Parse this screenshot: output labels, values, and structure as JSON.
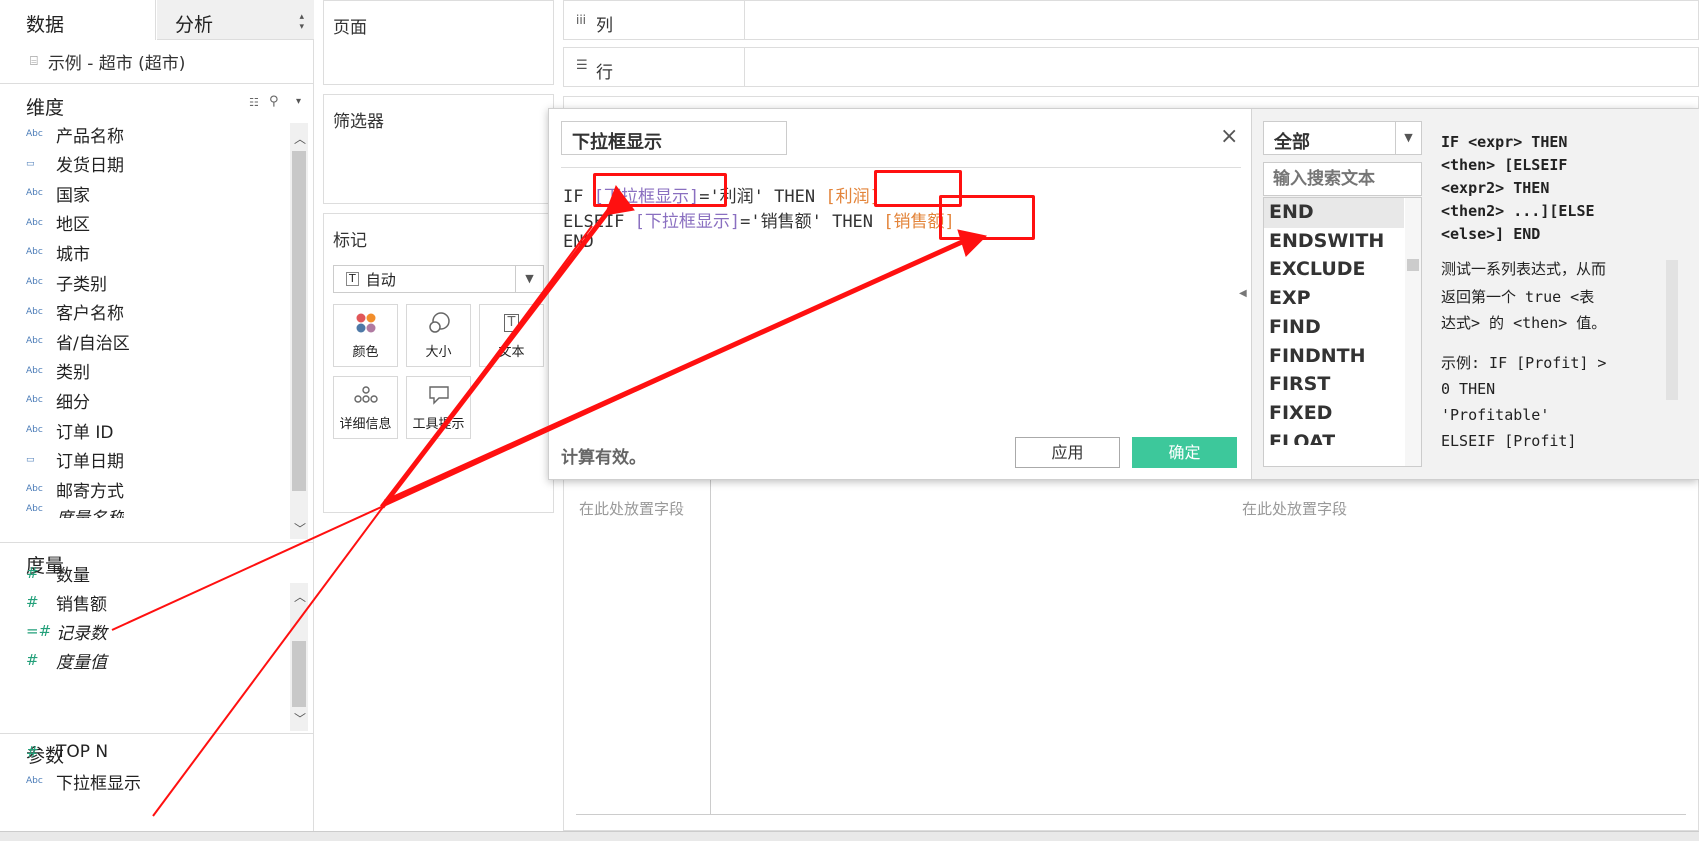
{
  "sidebar": {
    "tab_data": "数据",
    "tab_analysis": "分析",
    "datasource": "示例 - 超市 (超市)",
    "dimensions_header": "维度",
    "dimensions": [
      {
        "type": "Abc",
        "label": "产品名称"
      },
      {
        "type": "date",
        "label": "发货日期"
      },
      {
        "type": "Abc",
        "label": "国家"
      },
      {
        "type": "Abc",
        "label": "地区"
      },
      {
        "type": "Abc",
        "label": "城市"
      },
      {
        "type": "Abc",
        "label": "子类别"
      },
      {
        "type": "Abc",
        "label": "客户名称"
      },
      {
        "type": "Abc",
        "label": "省/自治区"
      },
      {
        "type": "Abc",
        "label": "类别"
      },
      {
        "type": "Abc",
        "label": "细分"
      },
      {
        "type": "Abc",
        "label": "订单 ID"
      },
      {
        "type": "date",
        "label": "订单日期"
      },
      {
        "type": "Abc",
        "label": "邮寄方式"
      },
      {
        "type": "Abc",
        "label": "度量名称"
      }
    ],
    "measures_header": "度量",
    "measures": [
      {
        "type": "#",
        "label": "数量"
      },
      {
        "type": "#",
        "label": "销售额"
      },
      {
        "type": "=#",
        "label": "记录数"
      },
      {
        "type": "#",
        "label": "度量值"
      }
    ],
    "params_header": "参数",
    "params": [
      {
        "type": "#",
        "label": "TOP N"
      },
      {
        "type": "Abc",
        "label": "下拉框显示"
      }
    ]
  },
  "shelves": {
    "pages": "页面",
    "filters": "筛选器",
    "marks": "标记",
    "marks_type": "自动",
    "mark_color": "颜色",
    "mark_size": "大小",
    "mark_text": "文本",
    "mark_detail": "详细信息",
    "mark_tooltip": "工具提示",
    "columns_label": "列",
    "rows_label": "行",
    "columns_icon": "iii",
    "rows_icon": "☰",
    "drop_field_1": "在此处放置字段",
    "drop_field_2": "在此处放置字段"
  },
  "calc_dialog": {
    "name": "下拉框显示",
    "code": {
      "l1_if": "IF ",
      "l1_field": "[下拉框显示]",
      "l1_mid": "='利润' THEN ",
      "l1_val": "[利润]",
      "l2_elseif": "ELSEIF ",
      "l2_field": "[下拉框显示]",
      "l2_mid": "='销售额' THEN ",
      "l2_val": "[销售额]",
      "l3_end": "END"
    },
    "status": "计算有效。",
    "apply": "应用",
    "ok": "确定"
  },
  "functions_panel": {
    "category": "全部",
    "search_placeholder": "输入搜索文本",
    "functions": [
      "END",
      "ENDSWITH",
      "EXCLUDE",
      "EXP",
      "FIND",
      "FINDNTH",
      "FIRST",
      "FIXED",
      "FLOAT"
    ],
    "help_syntax_1": "IF <expr> THEN",
    "help_syntax_2": "<then> [ELSEIF",
    "help_syntax_3": "<expr2> THEN",
    "help_syntax_4": "<then2> ...][ELSE",
    "help_syntax_5": "<else>] END",
    "help_desc_1": "测试一系列表达式，从而",
    "help_desc_2": "返回第一个 true <表",
    "help_desc_3": "达式> 的 <then> 值。",
    "help_ex_1": "示例: IF [Profit] >",
    "help_ex_2": "0 THEN",
    "help_ex_3": "'Profitable'",
    "help_ex_4": "ELSEIF [Profit]"
  },
  "colors": {
    "accent": "#3dc89b",
    "annotation": "#ff1010",
    "field_blue": "#8a6fc0",
    "field_orange": "#e3843a"
  }
}
